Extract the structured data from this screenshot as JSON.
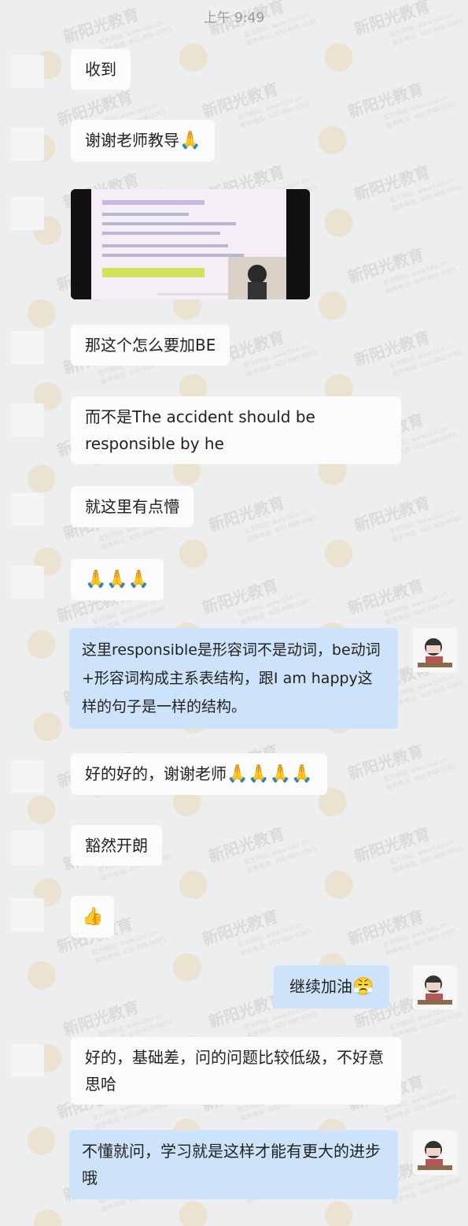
{
  "status": {
    "time": "上午 9:49"
  },
  "watermark": {
    "brand": "新阳光教育",
    "line1": "官方网站: www.tdxl.cn",
    "line2": "服务电话: 400-888-0085"
  },
  "messages": [
    {
      "text": "收到"
    },
    {
      "text": "谢谢老师教导",
      "emoji": "🙏"
    },
    {
      "type": "video"
    },
    {
      "text": "那这个怎么要加BE"
    },
    {
      "text": "而不是The accident should be responsible by he"
    },
    {
      "text": "就这里有点懵"
    },
    {
      "emoji": "🙏🙏🙏"
    },
    {
      "text": "这里responsible是形容词不是动词，be动词+形容词构成主系表结构，跟I am happy这样的句子是一样的结构。"
    },
    {
      "text": "好的好的，谢谢老师",
      "emoji": "🙏🙏🙏🙏"
    },
    {
      "text": "豁然开朗"
    },
    {
      "emoji": "👍"
    },
    {
      "text": "继续加油",
      "emoji": "😤"
    },
    {
      "text": "好的，基础差，问的问题比较低级，不好意思哈"
    },
    {
      "text": "不懂就问，学习就是这样才能有更大的进步哦"
    }
  ],
  "colors": {
    "background": "#eceef0",
    "incoming": "#fbfbfb",
    "outgoing": "#cde3fb"
  }
}
